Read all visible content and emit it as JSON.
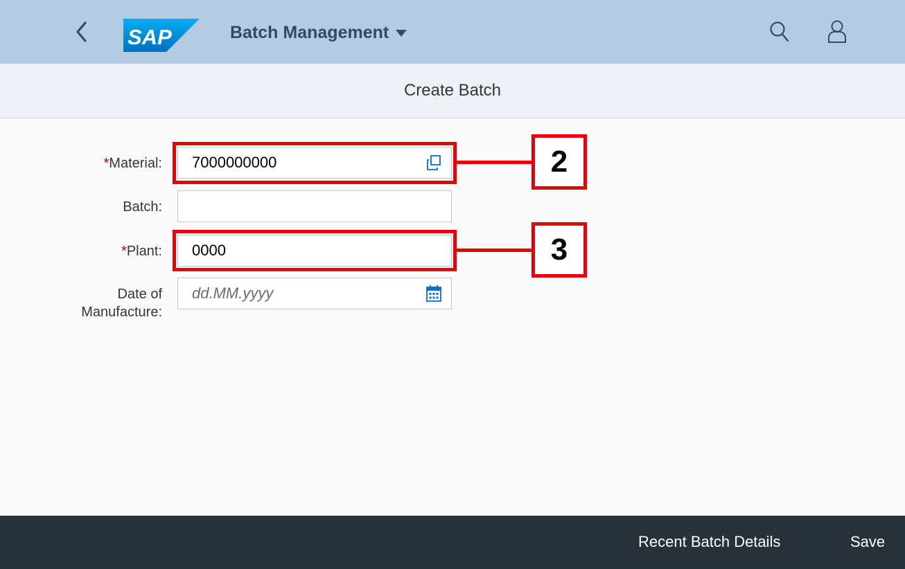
{
  "shell": {
    "app_title": "Batch Management",
    "logo_text": "SAP",
    "back_icon": "chevron-left-icon",
    "search_icon": "search-icon",
    "user_icon": "user-icon",
    "bg_color": "#b3cbe3"
  },
  "page": {
    "title": "Create Batch"
  },
  "form": {
    "required_marker": "*",
    "material": {
      "label": "Material:",
      "value": "7000000000",
      "required": true,
      "icon": "value-help-icon"
    },
    "batch": {
      "label": "Batch:",
      "value": "",
      "required": false
    },
    "plant": {
      "label": "Plant:",
      "value": "0000",
      "required": true
    },
    "manufacture_date": {
      "label_line1": "Date of",
      "label_line2": "Manufacture:",
      "placeholder": "dd.MM.yyyy",
      "value": "",
      "icon": "calendar-icon"
    }
  },
  "annotations": {
    "callout_2": "2",
    "callout_3": "3",
    "color": "#e8000b"
  },
  "footer": {
    "recent_label": "Recent Batch Details",
    "save_label": "Save",
    "bg_color": "#29313a"
  }
}
